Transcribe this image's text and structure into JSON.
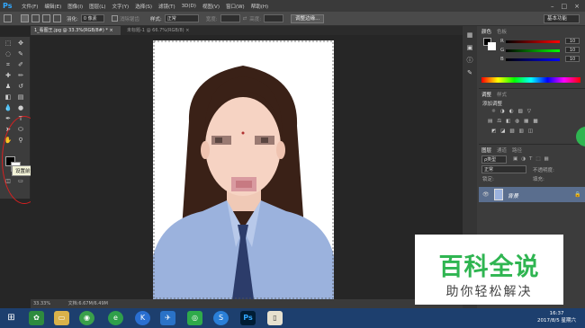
{
  "app": {
    "logo": "Ps",
    "colors": {
      "ps_blue": "#31a8ff",
      "watermark_green": "#2fb551",
      "annotation_red": "#d82020"
    }
  },
  "menu": [
    "文件(F)",
    "编辑(E)",
    "图像(I)",
    "图层(L)",
    "文字(Y)",
    "选择(S)",
    "滤镜(T)",
    "3D(D)",
    "视图(V)",
    "窗口(W)",
    "帮助(H)"
  ],
  "window_controls": [
    "–",
    "□",
    "×"
  ],
  "options": {
    "feather_label": "羽化:",
    "feather_value": "0 像素",
    "antialias_label": "消除锯齿",
    "style_label": "样式:",
    "style_value": "正常",
    "width_label": "宽度:",
    "height_label": "高度:",
    "refine_button": "调整边缘...",
    "workspace": "基本功能"
  },
  "tabs": [
    {
      "label": "1_看图王.jpg @ 33.3%(RGB/8#) *",
      "close": "×"
    },
    {
      "label": "未标题-1 @ 66.7%(RGB/8)",
      "close": "×"
    }
  ],
  "tooltip": "设置前景色",
  "status": {
    "zoom": "33.33%",
    "doc": "文档:6.67M/6.49M"
  },
  "color_panel": {
    "tabs": [
      "颜色",
      "色板"
    ],
    "channels": [
      {
        "label": "R",
        "value": "10"
      },
      {
        "label": "G",
        "value": "10"
      },
      {
        "label": "B",
        "value": "10"
      }
    ]
  },
  "adjust_panel": {
    "tabs": [
      "调整",
      "样式"
    ],
    "title": "添加调整"
  },
  "layers_panel": {
    "tabs": [
      "图层",
      "通道",
      "路径"
    ],
    "kind": "ρ类型",
    "blend": "正常",
    "opacity_label": "不透明度:",
    "lock_label": "锁定:",
    "fill_label": "填充:",
    "layer_name": "背景"
  },
  "watermark": {
    "big": "百科全说",
    "small": "助你轻松解决"
  },
  "taskbar": {
    "time": "16:37",
    "date": "2017/8/5 星期六"
  }
}
